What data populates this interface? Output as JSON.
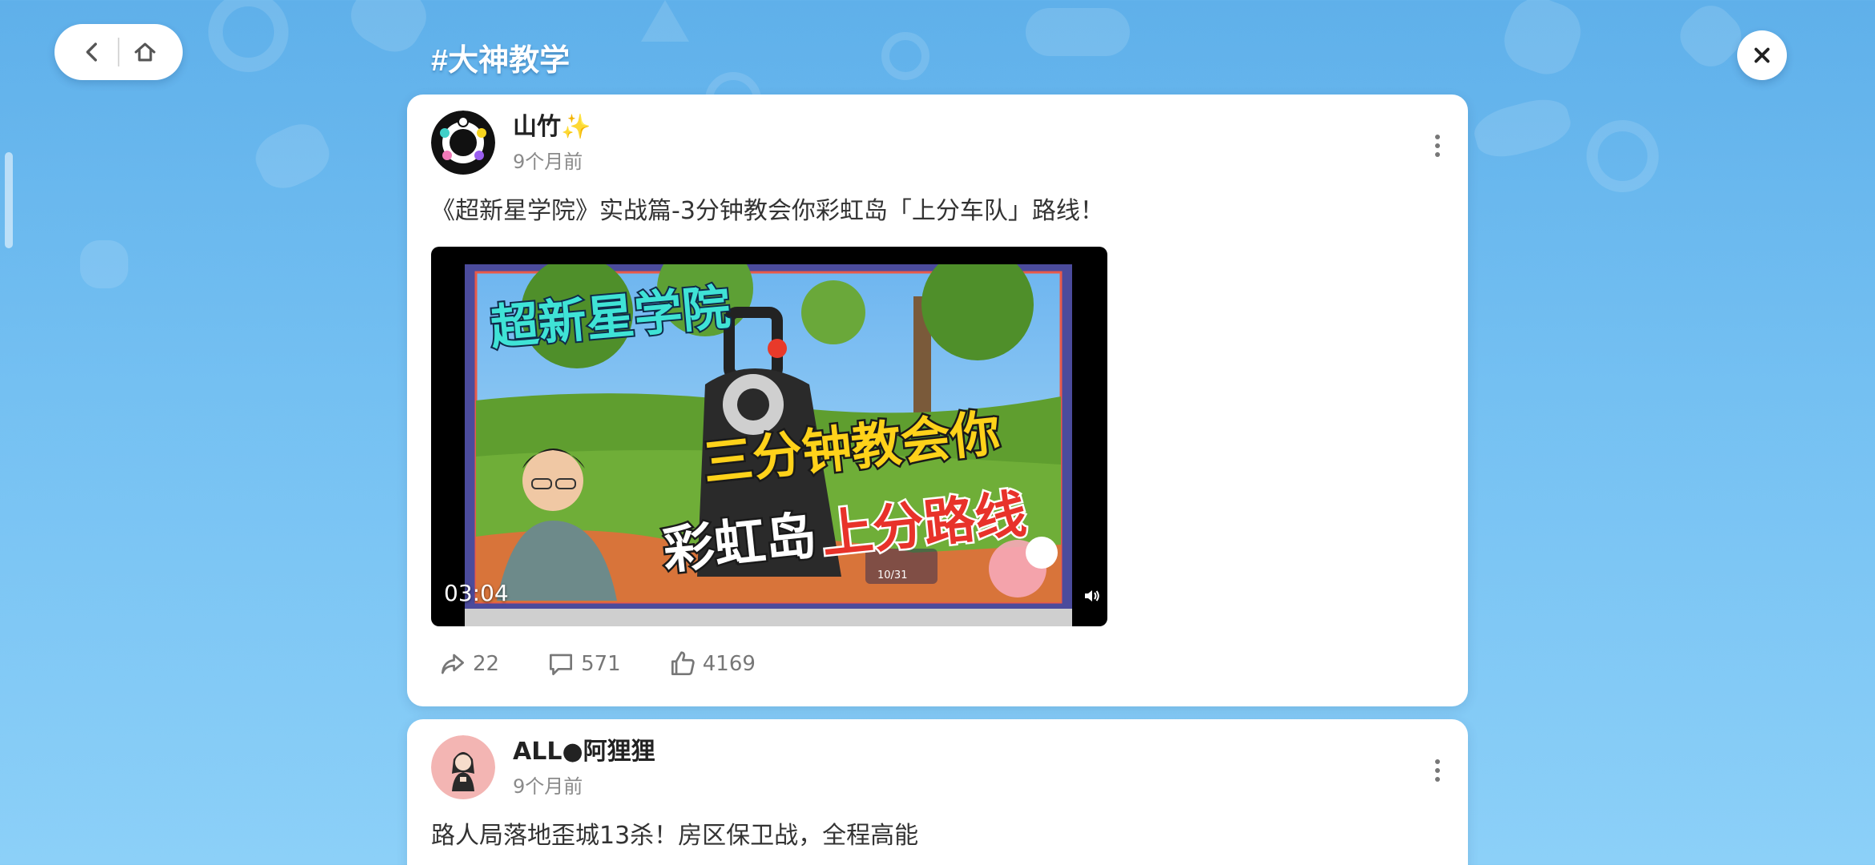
{
  "topic": {
    "title": "#大神教学"
  },
  "nav": {
    "back_icon": "chevron-left-icon",
    "home_icon": "home-icon",
    "close_icon": "close-icon"
  },
  "posts": [
    {
      "author": "山竹✨",
      "time": "9个月前",
      "text": "《超新星学院》实战篇-3分钟教会你彩虹岛「上分车队」路线！",
      "video": {
        "duration": "03:04",
        "title_top": "超新星学院",
        "title_mid": "三分钟教会你",
        "title_bottom_white": "彩虹岛",
        "title_bottom_red": "上分路线",
        "hud_ammo": "10/31"
      },
      "stats": {
        "shares": "22",
        "comments": "571",
        "likes": "4169"
      }
    },
    {
      "author": "ALL●阿狸狸",
      "time": "9个月前",
      "text": "路人局落地歪城13杀！房区保卫战，全程高能"
    }
  ],
  "colors": {
    "background": "#6cb9ef",
    "card": "#ffffff",
    "accent_red": "#e8322a",
    "accent_yellow": "#ffd21a"
  }
}
